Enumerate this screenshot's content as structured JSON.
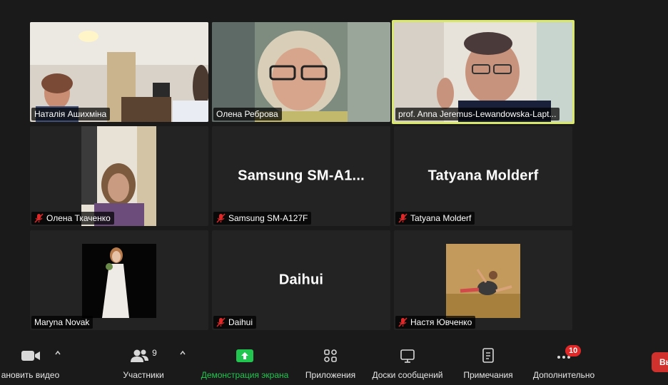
{
  "participants": [
    {
      "name": "Наталія Ашихміна",
      "muted": false,
      "video": true
    },
    {
      "name": "Олена Реброва",
      "muted": false,
      "video": true
    },
    {
      "name": "prof. Anna Jeremus-Lewandowska-Lapt...",
      "muted": false,
      "video": true,
      "active_speaker": true
    },
    {
      "name": "Олена Ткаченко",
      "muted": true,
      "video": true
    },
    {
      "name": "Samsung SM-A127F",
      "display": "Samsung  SM-A1...",
      "muted": true,
      "video": false
    },
    {
      "name": "Tatyana Molderf",
      "display": "Tatyana Molderf",
      "muted": true,
      "video": false
    },
    {
      "name": "Maryna Novak",
      "muted": false,
      "video": true
    },
    {
      "name": "Daihui",
      "display": "Daihui",
      "muted": true,
      "video": false
    },
    {
      "name": "Настя Ювченко",
      "muted": true,
      "video": true
    }
  ],
  "toolbar": {
    "video_label": "ановить видео",
    "participants_label": "Участники",
    "participants_count": "9",
    "share_label": "Демонстрация экрана",
    "apps_label": "Приложения",
    "whiteboards_label": "Доски сообщений",
    "notes_label": "Примечания",
    "more_label": "Дополнительно",
    "more_badge": "10",
    "end_label": "Вы"
  },
  "colors": {
    "background": "#1a1a1a",
    "tile": "#232323",
    "active_border": "#d9e86b",
    "share_green": "#23c551",
    "muted_red": "#e02828",
    "badge_red": "#e02828"
  },
  "icons": {
    "video": "video-camera-icon",
    "participants": "people-icon",
    "share": "share-screen-icon",
    "apps": "apps-icon",
    "whiteboards": "whiteboard-icon",
    "notes": "notes-icon",
    "more": "more-dots-icon",
    "muted": "mic-muted-icon"
  }
}
